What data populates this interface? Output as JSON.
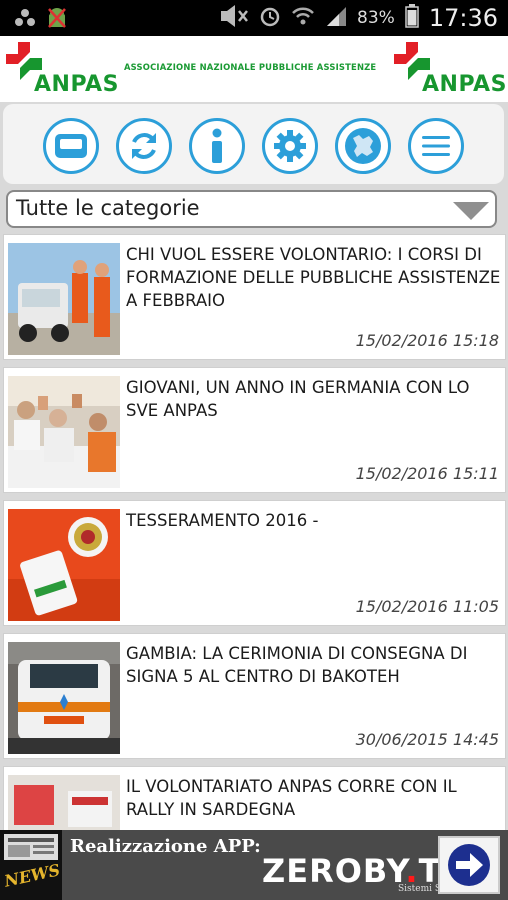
{
  "status_bar": {
    "battery_percent": "83%",
    "time": "17:36"
  },
  "header": {
    "logo_left": "ANPAS",
    "title": "ASSOCIAZIONE NAZIONALE PUBBLICHE ASSISTENZE",
    "logo_right": "ANPAS",
    "brand_green": "#17962f",
    "brand_red": "#e21f26"
  },
  "toolbar": {
    "accent": "#2c9fd9",
    "buttons": [
      {
        "icon": "news-card-icon"
      },
      {
        "icon": "refresh-icon"
      },
      {
        "icon": "info-icon"
      },
      {
        "icon": "settings-icon"
      },
      {
        "icon": "europe-globe-icon"
      },
      {
        "icon": "menu-icon"
      }
    ]
  },
  "category_select": {
    "selected": "Tutte le categorie"
  },
  "news": [
    {
      "title": "CHI VUOL ESSERE VOLONTARIO: I CORSI DI FORMAZIONE DELLE PUBBLICHE ASSISTENZE A FEBBRAIO",
      "date": "15/02/2016 15:18"
    },
    {
      "title": "GIOVANI, UN ANNO IN GERMANIA CON LO SVE ANPAS",
      "date": "15/02/2016 15:11"
    },
    {
      "title": "TESSERAMENTO 2016 -",
      "date": "15/02/2016 11:05"
    },
    {
      "title": "GAMBIA: LA CERIMONIA DI CONSEGNA DI SIGNA 5 AL CENTRO DI BAKOTEH",
      "date": "30/06/2015 14:45"
    },
    {
      "title": "IL VOLONTARIATO ANPAS CORRE CON IL RALLY IN SARDEGNA",
      "date": ""
    }
  ],
  "footer": {
    "news_label": "NEWS",
    "realizzazione": "Realizzazione APP:",
    "brand_part1": "ZEROBY",
    "brand_dot": ".",
    "brand_part2": "TE",
    "brand_sub": "Sistemi Srl"
  }
}
